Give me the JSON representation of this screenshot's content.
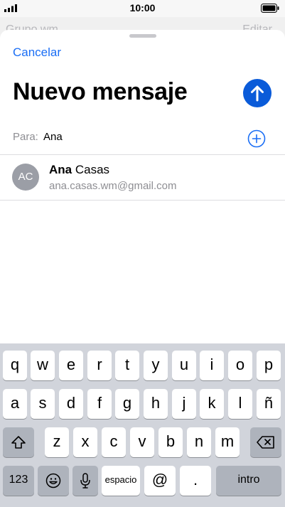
{
  "status_bar": {
    "time": "10:00"
  },
  "background_app": {
    "back_label": "Grupo wm",
    "edit_label": "Editar"
  },
  "compose": {
    "cancel_label": "Cancelar",
    "title": "Nuevo mensaje",
    "to_label": "Para:",
    "to_value": "Ana"
  },
  "suggestion": {
    "initials": "AC",
    "name_match": "Ana",
    "name_rest": " Casas",
    "email": "ana.casas.wm@gmail.com"
  },
  "keyboard": {
    "row1": [
      "q",
      "w",
      "e",
      "r",
      "t",
      "y",
      "u",
      "i",
      "o",
      "p"
    ],
    "row2": [
      "a",
      "s",
      "d",
      "f",
      "g",
      "h",
      "j",
      "k",
      "l",
      "ñ"
    ],
    "row3": [
      "z",
      "x",
      "c",
      "v",
      "b",
      "n",
      "m"
    ],
    "numbers_label": "123",
    "space_label": "espacio",
    "at_label": "@",
    "dot_label": ".",
    "return_label": "intro"
  },
  "colors": {
    "accent": "#1a6ef5",
    "send_button": "#0a5bd9",
    "keyboard_bg": "#d1d4db"
  },
  "icons": [
    "signal-icon",
    "battery-icon",
    "send-arrow-icon",
    "add-contact-icon",
    "shift-icon",
    "delete-icon",
    "emoji-icon",
    "microphone-icon"
  ]
}
